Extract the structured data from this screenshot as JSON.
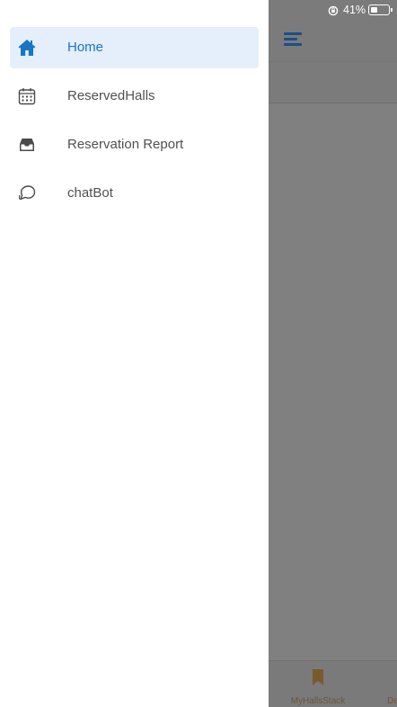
{
  "status_bar": {
    "battery_text": "41%",
    "battery_level": 0.41,
    "rotation_lock_icon": "rotation-lock-icon"
  },
  "drawer": {
    "items": [
      {
        "label": "Home",
        "icon": "home-icon",
        "active": true
      },
      {
        "label": "ReservedHalls",
        "icon": "calendar-icon",
        "active": false
      },
      {
        "label": "Reservation Report",
        "icon": "inbox-icon",
        "active": false
      },
      {
        "label": "chatBot",
        "icon": "chat-bubble-icon",
        "active": false
      }
    ]
  },
  "underlying_screen": {
    "menu_icon": "hamburger-menu-icon",
    "tab_bar": {
      "tabs": [
        {
          "label": "MyHallsStack",
          "icon": "bookmark-icon"
        },
        {
          "label": "De"
        }
      ]
    }
  },
  "colors": {
    "active_text": "#1775c4",
    "active_bg": "#e4effb",
    "inactive_text": "#505050",
    "overlay": "#808080",
    "menu_icon": "#1b4f86",
    "tab_accent": "#7a5a2c"
  }
}
